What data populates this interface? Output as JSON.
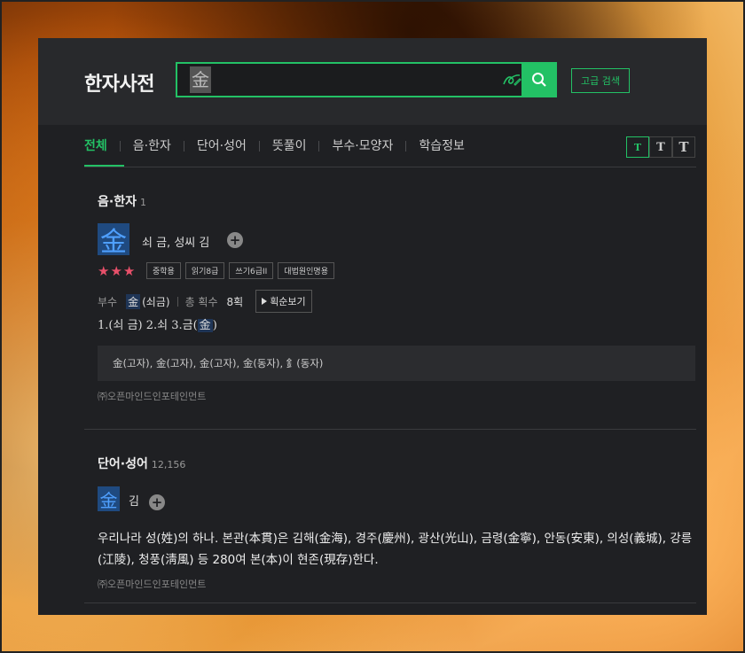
{
  "app": {
    "title": "한자사전"
  },
  "search": {
    "query": "金",
    "button_label": "검색",
    "advanced_label": "고급 검색"
  },
  "tabs": [
    {
      "label": "전체",
      "active": true
    },
    {
      "label": "음·한자"
    },
    {
      "label": "단어·성어"
    },
    {
      "label": "뜻풀이"
    },
    {
      "label": "부수·모양자"
    },
    {
      "label": "학습정보"
    }
  ],
  "font_size_buttons": [
    "T",
    "T",
    "T"
  ],
  "sections": {
    "eum_hanja": {
      "title": "음·한자",
      "count": "1",
      "entry": {
        "hanja": "金",
        "meaning": "쇠 금, 성씨 김",
        "stars": "★★★",
        "badges": [
          "중학용",
          "읽기8급",
          "쓰기6급II",
          "대법원인명용"
        ],
        "radical_label": "부수",
        "radical_hanja": "金",
        "radical_reading": "(쇠금)",
        "stroke_label": "총 획수",
        "stroke_value": "8획",
        "stroke_order_button": "획순보기",
        "meanings_pre": "1.(쇠 금) 2.쇠 3.금(",
        "meanings_hanja": "金",
        "meanings_post": ")",
        "variants": "金(고자), 金(고자), 金(고자), 金(동자), 釒(동자)",
        "source": "㈜오픈마인드인포테인먼트"
      }
    },
    "word_idiom": {
      "title": "단어·성어",
      "count": "12,156",
      "entry": {
        "hanja": "金",
        "reading": "김",
        "description": "우리나라 성(姓)의 하나. 본관(本貫)은 김해(金海), 경주(慶州), 광산(光山), 금령(金寧), 안동(安東), 의성(義城), 강릉(江陵), 청풍(淸風) 등 280여 본(本)이 현존(現存)한다.",
        "source": "㈜오픈마인드인포테인먼트"
      }
    }
  },
  "colors": {
    "accent": "#23c165",
    "panel": "#1f2023",
    "header": "#28292c",
    "hanja_bg": "#1f4a80",
    "star": "#e8506a"
  },
  "icons": [
    "handwriting-icon",
    "dropdown-arrow-icon",
    "search-icon",
    "plus-circle-icon",
    "play-icon"
  ]
}
